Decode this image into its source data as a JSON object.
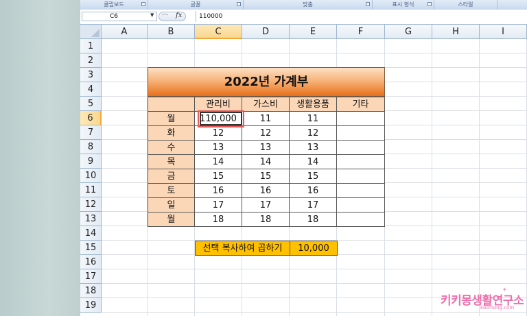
{
  "ribbon": {
    "groups": [
      "클립보드",
      "글꼴",
      "맞춤",
      "표시 형식",
      "스타일"
    ]
  },
  "formula_bar": {
    "name_box": "C6",
    "fx": "fx",
    "value": "110000"
  },
  "columns": [
    "A",
    "B",
    "C",
    "D",
    "E",
    "F",
    "G",
    "H",
    "I"
  ],
  "rows": [
    "1",
    "2",
    "3",
    "4",
    "5",
    "6",
    "7",
    "8",
    "9",
    "10",
    "11",
    "12",
    "13",
    "14",
    "15",
    "16",
    "17",
    "18",
    "19"
  ],
  "selected_column": "C",
  "selected_row": "6",
  "table": {
    "title": "2022년 가계부",
    "headers": [
      "관리비",
      "가스비",
      "생활용품",
      "기타"
    ],
    "rows": [
      {
        "day": "월",
        "values": [
          "110,000",
          "11",
          "11",
          ""
        ]
      },
      {
        "day": "화",
        "values": [
          "12",
          "12",
          "12",
          ""
        ]
      },
      {
        "day": "수",
        "values": [
          "13",
          "13",
          "13",
          ""
        ]
      },
      {
        "day": "목",
        "values": [
          "14",
          "14",
          "14",
          ""
        ]
      },
      {
        "day": "금",
        "values": [
          "15",
          "15",
          "15",
          ""
        ]
      },
      {
        "day": "토",
        "values": [
          "16",
          "16",
          "16",
          ""
        ]
      },
      {
        "day": "일",
        "values": [
          "17",
          "17",
          "17",
          ""
        ]
      },
      {
        "day": "월",
        "values": [
          "18",
          "18",
          "18",
          ""
        ]
      }
    ]
  },
  "instruction": {
    "label": "선택 복사하여 곱하기",
    "value": "10,000"
  },
  "brand": {
    "name": "키키몽생활연구소",
    "url": "kikimong.com"
  },
  "colors": {
    "title_gradient_end": "#e8701a",
    "header_fill": "#fbd7b8",
    "highlight_fill": "#ffc000",
    "selection_outline": "#e65a5a",
    "brand_pink": "#ee6fae"
  }
}
